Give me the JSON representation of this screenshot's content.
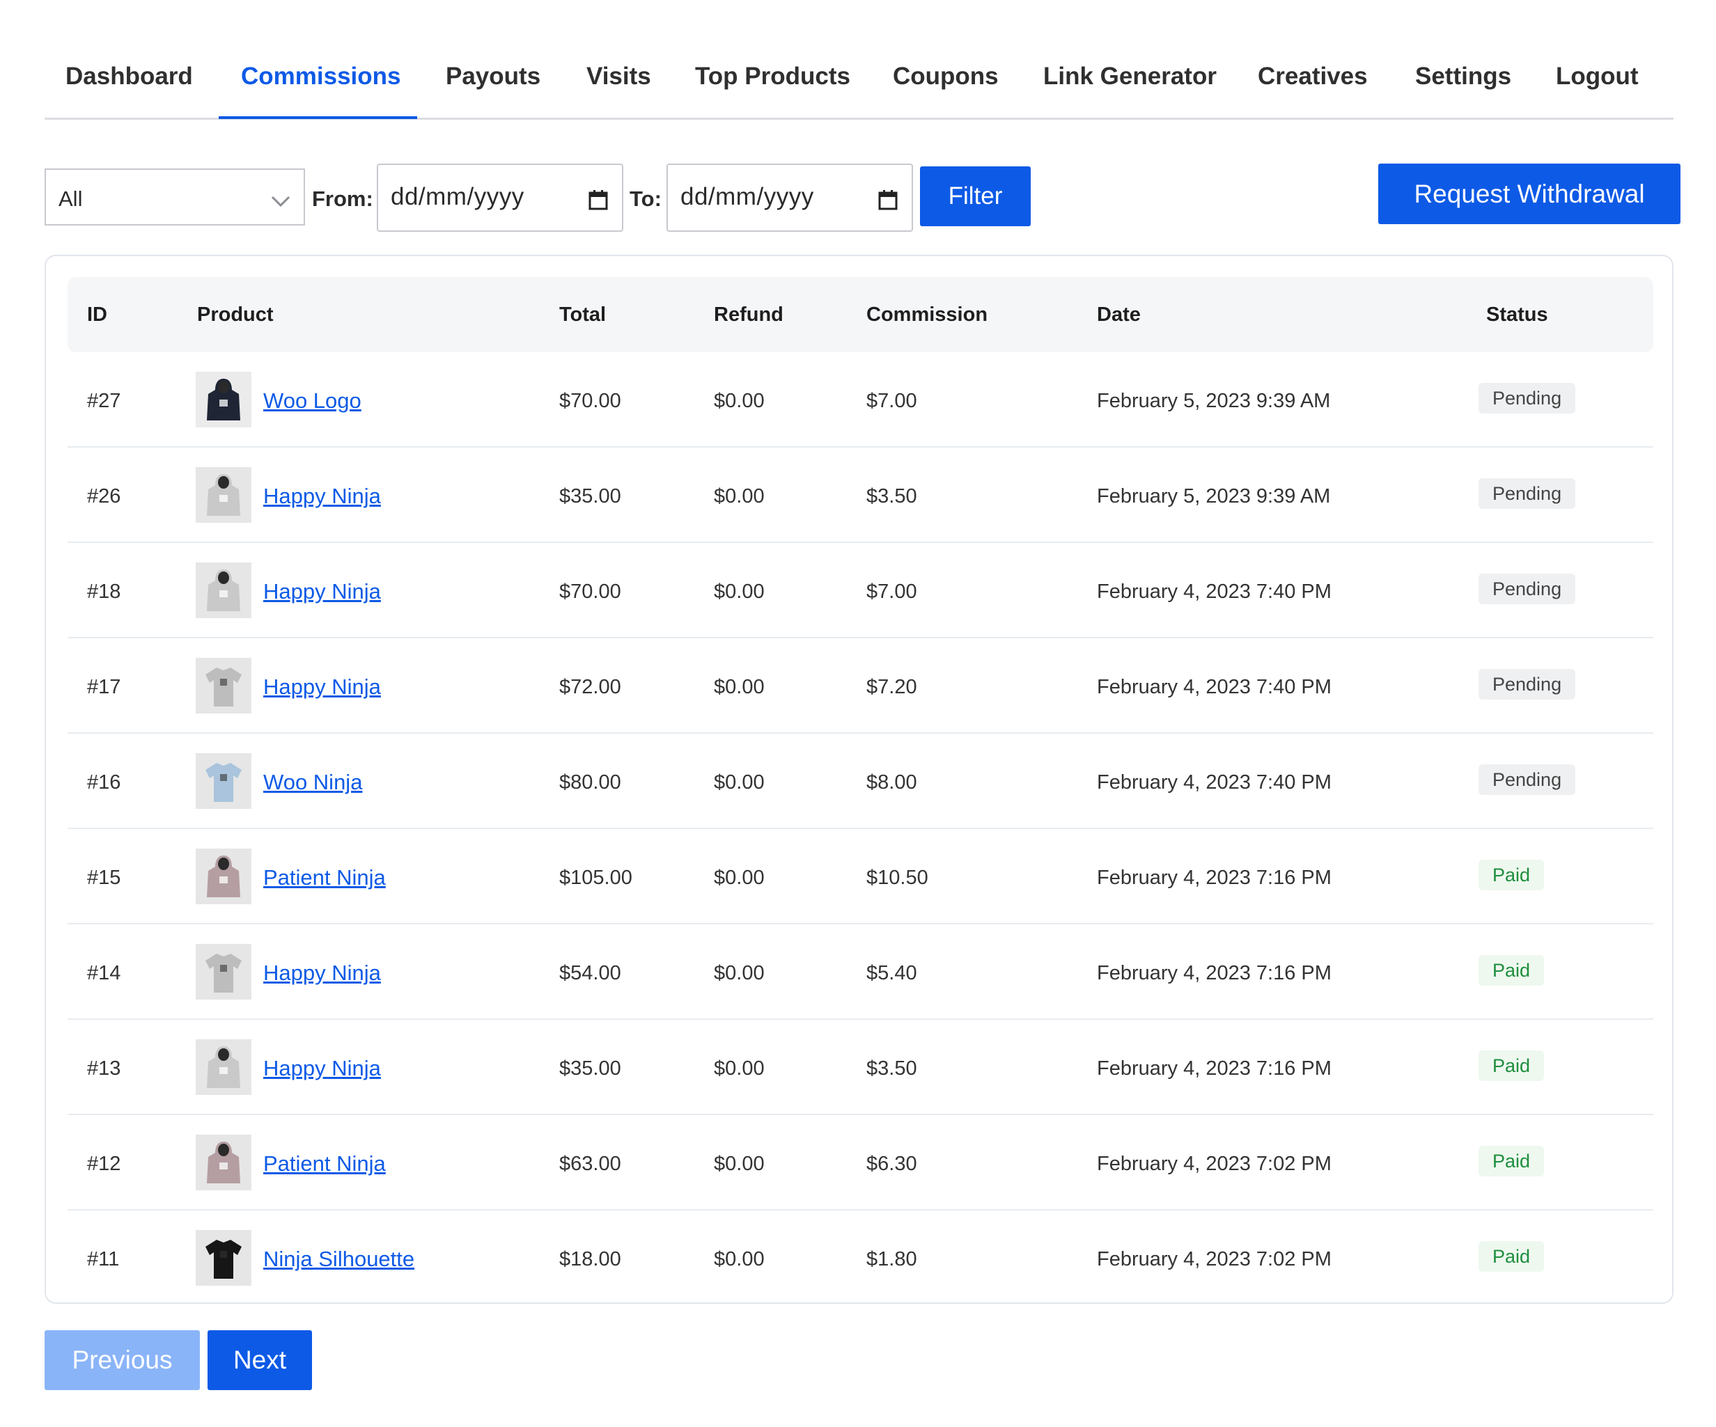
{
  "nav": {
    "items": [
      {
        "label": "Dashboard",
        "active": false
      },
      {
        "label": "Commissions",
        "active": true
      },
      {
        "label": "Payouts",
        "active": false
      },
      {
        "label": "Visits",
        "active": false
      },
      {
        "label": "Top Products",
        "active": false
      },
      {
        "label": "Coupons",
        "active": false
      },
      {
        "label": "Link Generator",
        "active": false
      },
      {
        "label": "Creatives",
        "active": false
      },
      {
        "label": "Settings",
        "active": false
      },
      {
        "label": "Logout",
        "active": false
      }
    ]
  },
  "filters": {
    "status_value": "All",
    "from_label": "From:",
    "from_placeholder": "dd/mm/yyyy",
    "to_label": "To:",
    "to_placeholder": "dd/mm/yyyy",
    "filter_label": "Filter",
    "withdraw_label": "Request Withdrawal"
  },
  "table": {
    "headers": {
      "id": "ID",
      "product": "Product",
      "total": "Total",
      "refund": "Refund",
      "commission": "Commission",
      "date": "Date",
      "status": "Status"
    },
    "rows": [
      {
        "id": "#27",
        "product": "Woo Logo",
        "thumb": "dark-hoodie",
        "total": "$70.00",
        "refund": "$0.00",
        "commission": "$7.00",
        "date": "February 5, 2023 9:39 AM",
        "status": "Pending"
      },
      {
        "id": "#26",
        "product": "Happy Ninja",
        "thumb": "grey-hoodie",
        "total": "$35.00",
        "refund": "$0.00",
        "commission": "$3.50",
        "date": "February 5, 2023 9:39 AM",
        "status": "Pending"
      },
      {
        "id": "#18",
        "product": "Happy Ninja",
        "thumb": "grey-hoodie",
        "total": "$70.00",
        "refund": "$0.00",
        "commission": "$7.00",
        "date": "February 4, 2023 7:40 PM",
        "status": "Pending"
      },
      {
        "id": "#17",
        "product": "Happy Ninja",
        "thumb": "grey-tshirt",
        "total": "$72.00",
        "refund": "$0.00",
        "commission": "$7.20",
        "date": "February 4, 2023 7:40 PM",
        "status": "Pending"
      },
      {
        "id": "#16",
        "product": "Woo Ninja",
        "thumb": "blue-tshirt",
        "total": "$80.00",
        "refund": "$0.00",
        "commission": "$8.00",
        "date": "February 4, 2023 7:40 PM",
        "status": "Pending"
      },
      {
        "id": "#15",
        "product": "Patient Ninja",
        "thumb": "pink-hoodie",
        "total": "$105.00",
        "refund": "$0.00",
        "commission": "$10.50",
        "date": "February 4, 2023 7:16 PM",
        "status": "Paid"
      },
      {
        "id": "#14",
        "product": "Happy Ninja",
        "thumb": "grey-tshirt",
        "total": "$54.00",
        "refund": "$0.00",
        "commission": "$5.40",
        "date": "February 4, 2023 7:16 PM",
        "status": "Paid"
      },
      {
        "id": "#13",
        "product": "Happy Ninja",
        "thumb": "grey-hoodie",
        "total": "$35.00",
        "refund": "$0.00",
        "commission": "$3.50",
        "date": "February 4, 2023 7:16 PM",
        "status": "Paid"
      },
      {
        "id": "#12",
        "product": "Patient Ninja",
        "thumb": "pink-hoodie",
        "total": "$63.00",
        "refund": "$0.00",
        "commission": "$6.30",
        "date": "February 4, 2023 7:02 PM",
        "status": "Paid"
      },
      {
        "id": "#11",
        "product": "Ninja Silhouette",
        "thumb": "black-tshirt",
        "total": "$18.00",
        "refund": "$0.00",
        "commission": "$1.80",
        "date": "February 4, 2023 7:02 PM",
        "status": "Paid"
      }
    ]
  },
  "pagination": {
    "previous_label": "Previous",
    "next_label": "Next",
    "previous_disabled": true
  },
  "colors": {
    "accent": "#0d5ae6",
    "accent_disabled": "#8ab4f8",
    "pending_bg": "#eff0f2",
    "paid_bg": "#eef8ef",
    "paid_text": "#1e8e3e"
  }
}
